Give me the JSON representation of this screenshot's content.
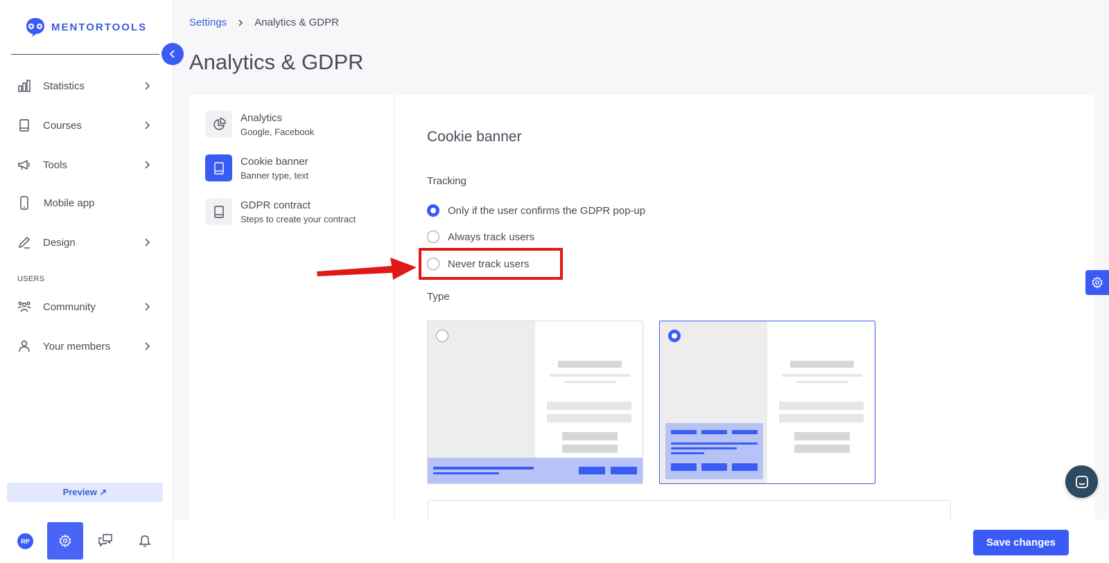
{
  "app": {
    "logo_text": "MENTORTOOLS",
    "accent": "#3b5bf5"
  },
  "sidebar": {
    "items": [
      {
        "label": "Statistics",
        "icon": "bar-chart-icon",
        "has_chevron": true
      },
      {
        "label": "Courses",
        "icon": "book-icon",
        "has_chevron": true
      },
      {
        "label": "Tools",
        "icon": "megaphone-icon",
        "has_chevron": true
      },
      {
        "label": "Mobile app",
        "icon": "phone-icon",
        "has_chevron": false
      },
      {
        "label": "Design",
        "icon": "pencil-icon",
        "has_chevron": true
      },
      {
        "label": "Community",
        "icon": "group-icon",
        "has_chevron": true
      },
      {
        "label": "Your members",
        "icon": "user-icon",
        "has_chevron": true
      }
    ],
    "section_users": "USERS",
    "preview_label": "Preview ↗",
    "avatar_initials": "RP"
  },
  "breadcrumb": {
    "parent": "Settings",
    "current": "Analytics & GDPR"
  },
  "page_title": "Analytics & GDPR",
  "subnav": [
    {
      "title": "Analytics",
      "subtitle": "Google, Facebook",
      "icon": "pie-chart-icon",
      "active": false
    },
    {
      "title": "Cookie banner",
      "subtitle": "Banner type, text",
      "icon": "document-icon",
      "active": true
    },
    {
      "title": "GDPR contract",
      "subtitle": "Steps to create your contract",
      "icon": "document-icon",
      "active": false
    }
  ],
  "cookie_banner": {
    "title": "Cookie banner",
    "tracking_label": "Tracking",
    "tracking_options": [
      {
        "label": "Only if the user confirms the GDPR pop-up",
        "selected": true
      },
      {
        "label": "Always track users",
        "selected": false
      },
      {
        "label": "Never track users",
        "selected": false
      }
    ],
    "type_label": "Type",
    "type_options": [
      {
        "name": "bottom-bar",
        "selected": false
      },
      {
        "name": "corner-box",
        "selected": true
      }
    ]
  },
  "footer": {
    "save_label": "Save changes"
  }
}
